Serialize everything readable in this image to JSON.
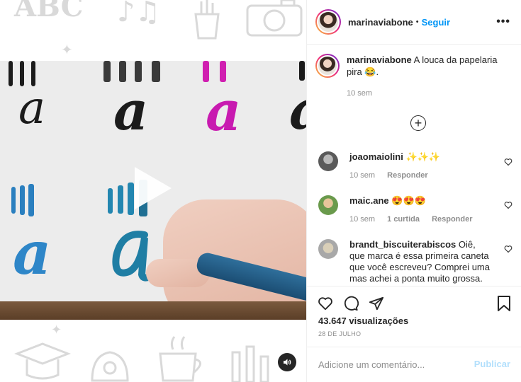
{
  "post": {
    "username": "marinaviabone",
    "follow_label": "Seguir",
    "separator": "•",
    "more_label": "•••",
    "caption": "A louca da papelaria pira 😂.",
    "caption_time": "10 sem",
    "load_more_symbol": "+"
  },
  "doodles": [
    "ABC",
    "♪♫",
    "✦",
    "✦"
  ],
  "video": {
    "letters": [
      "a",
      "a",
      "a",
      "a",
      "a"
    ],
    "sound_icon": "speaker-icon"
  },
  "comments": [
    {
      "user": "joaomaiolini",
      "text": "✨✨✨",
      "time": "10 sem",
      "reply": "Responder",
      "likes": ""
    },
    {
      "user": "maic.ane",
      "text": "😍😍😍",
      "time": "10 sem",
      "reply": "Responder",
      "likes": "1 curtida"
    },
    {
      "user": "brandt_biscuiterabiscos",
      "text": "Oiê, que marca é essa primeira caneta que você escreveu? Comprei uma mas achei a ponta muito grossa. Não",
      "time": "",
      "reply": "",
      "likes": ""
    }
  ],
  "stats": {
    "views": "43.647 visualizações",
    "date": "28 DE JULHO"
  },
  "composer": {
    "placeholder": "Adicione um comentário...",
    "publish_label": "Publicar"
  },
  "colors": {
    "accent": "#0095f6",
    "publish_disabled": "#b2dffc",
    "muted": "#8e8e8e"
  }
}
